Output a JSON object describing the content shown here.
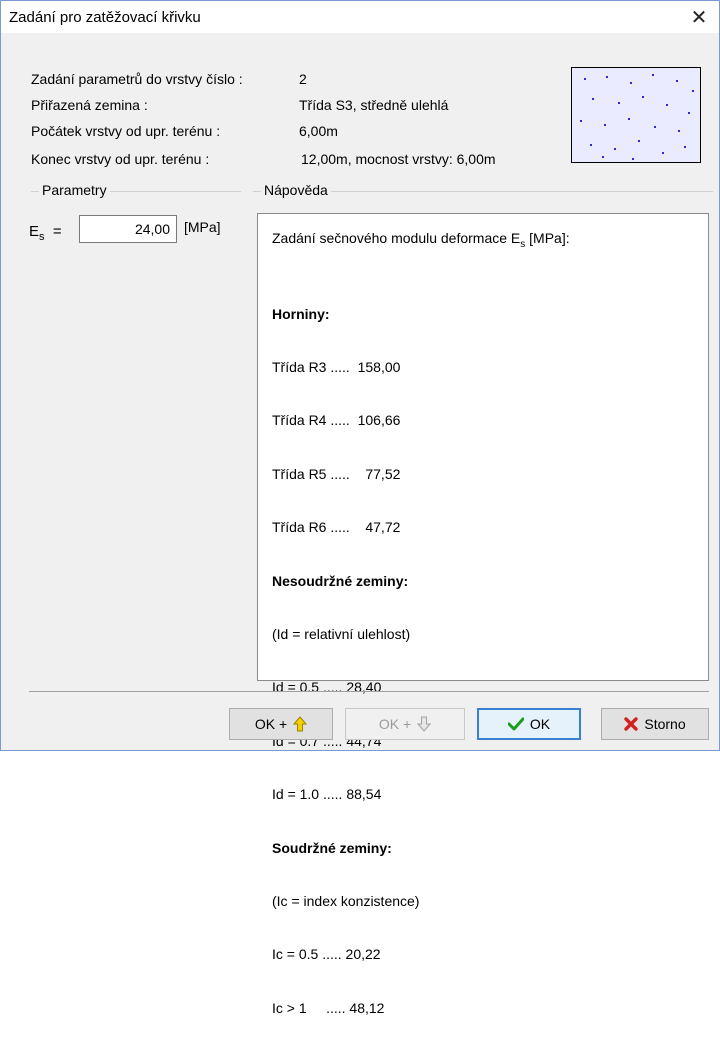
{
  "window": {
    "title": "Zadání pro zatěžovací křivku",
    "close_glyph": "✕"
  },
  "info": {
    "layer_label": "Zadání parametrů do vrstvy číslo :",
    "layer_value": "2",
    "soil_label": "Přiřazená zemina :",
    "soil_value": "Třída S3, středně ulehlá",
    "start_label": "Počátek vrstvy od upr. terénu :",
    "start_value": "6,00m",
    "end_label": "Konec vrstvy od upr. terénu :",
    "end_value": "12,00m, mocnost vrstvy: 6,00m"
  },
  "soil_pattern": {
    "background": "#ebebff",
    "dot_color": "#2b2bd6"
  },
  "parametry": {
    "group_title": "Parametry",
    "es_symbol": "E",
    "es_sub": "s",
    "es_eq": "=",
    "es_value": "24,00",
    "es_unit": "[MPa]"
  },
  "napoveda": {
    "group_title": "Nápověda",
    "intro_pre": "Zadání sečnového modulu deformace E",
    "intro_sub": "s",
    "intro_post": " [MPa]:",
    "sections": [
      {
        "header": "Horniny:",
        "lines": [
          "Třída R3 .....  158,00",
          "Třída R4 .....  106,66",
          "Třída R5 .....    77,52",
          "Třída R6 .....    47,72"
        ]
      },
      {
        "header": "Nesoudržné zeminy:",
        "lines": [
          "(Id = relativní ulehlost)",
          "Id = 0.5 ..... 28,40",
          "Id = 0.7 ..... 44,74",
          "Id = 1.0 ..... 88,54"
        ]
      },
      {
        "header": "Soudržné zeminy:",
        "lines": [
          "(Ic = index konzistence)",
          "Ic = 0.5 ..... 20,22",
          "Ic > 1     ..... 48,12"
        ]
      }
    ]
  },
  "buttons": {
    "ok_up": "OK +",
    "ok_down": "OK +",
    "ok": "OK",
    "storno": "Storno"
  },
  "colors": {
    "accent": "#3b7fd4",
    "arrow_up": "#d8b400",
    "check": "#1a9e1a",
    "cancel": "#d42020"
  }
}
